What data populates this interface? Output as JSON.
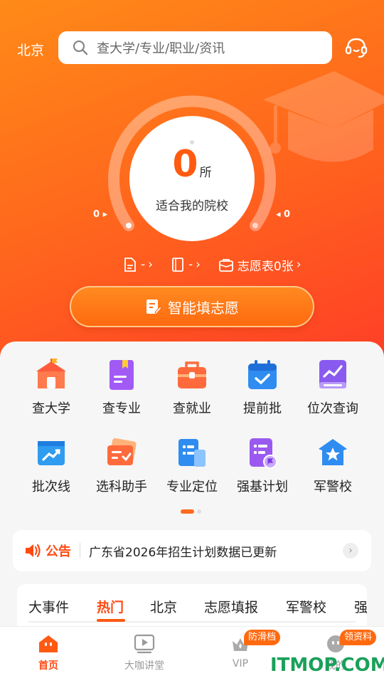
{
  "header": {
    "city": "北京",
    "search_placeholder": "查大学/专业/职业/资讯"
  },
  "gauge": {
    "count": "0",
    "unit": "所",
    "subtitle": "适合我的院校",
    "left_label": "0 ▸",
    "right_label": "◂ 0"
  },
  "stats": [
    {
      "value": "-",
      "icon": "document-icon"
    },
    {
      "value": "-",
      "icon": "book-icon"
    },
    {
      "value": "志愿表0张",
      "icon": "bag-icon"
    }
  ],
  "primary_button": "智能填志愿",
  "features": [
    {
      "label": "查大学",
      "icon": "school-icon"
    },
    {
      "label": "查专业",
      "icon": "major-book-icon"
    },
    {
      "label": "查就业",
      "icon": "briefcase-icon"
    },
    {
      "label": "提前批",
      "icon": "calendar-check-icon"
    },
    {
      "label": "位次查询",
      "icon": "rank-chart-icon"
    },
    {
      "label": "批次线",
      "icon": "trend-line-icon"
    },
    {
      "label": "选科助手",
      "icon": "subject-card-icon"
    },
    {
      "label": "专业定位",
      "icon": "position-doc-icon"
    },
    {
      "label": "强基计划",
      "icon": "plan-list-icon"
    },
    {
      "label": "军警校",
      "icon": "military-shield-icon"
    }
  ],
  "notice": {
    "tag": "公告",
    "text": "广东省2026年招生计划数据已更新"
  },
  "tabs": [
    "大事件",
    "热门",
    "北京",
    "志愿填报",
    "军警校",
    "强"
  ],
  "active_tab": "热门",
  "bottom_nav": [
    {
      "label": "首页",
      "icon": "home-icon",
      "active": true
    },
    {
      "label": "大咖讲堂",
      "icon": "video-play-icon",
      "active": false
    },
    {
      "label": "VIP",
      "icon": "vip-crown-icon",
      "active": false,
      "badge": "防滑档"
    },
    {
      "label": "我的",
      "icon": "profile-icon",
      "active": false,
      "badge": "领资料"
    }
  ],
  "watermark": "ITMOP.COM",
  "colors": {
    "brand": "#ff5a14",
    "accent": "#ff8a18"
  }
}
